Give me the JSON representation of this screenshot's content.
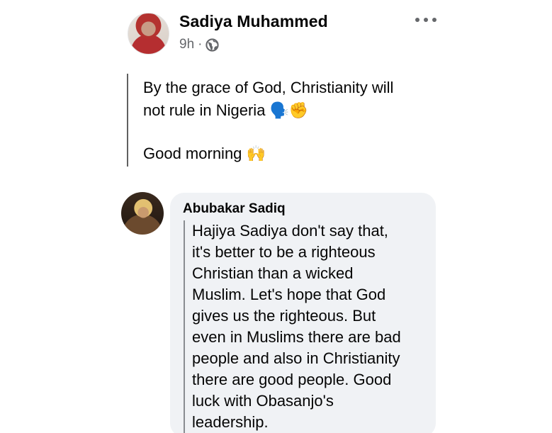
{
  "post": {
    "author": "Sadiya Muhammed",
    "time": "9h",
    "separator": "·",
    "privacy_icon": "globe-icon",
    "menu_icon": "more-horizontal-icon",
    "lines": [
      "By the grace of God, Christianity will",
      "not rule in Nigeria 🗣️✊",
      "Good morning 🙌"
    ]
  },
  "comment": {
    "author": "Abubakar Sadiq",
    "lines": [
      "Hajiya Sadiya don't say that,",
      "it's better to be a righteous",
      "Christian than a wicked",
      "Muslim. Let's hope that God",
      "gives us the righteous. But",
      "even in Muslims there are bad",
      "people and also in Christianity",
      "there are good people. Good",
      "luck with Obasanjo's",
      "leadership."
    ]
  },
  "colors": {
    "primary_text": "#050505",
    "secondary_text": "#65676b",
    "comment_bubble": "#f0f2f5"
  }
}
